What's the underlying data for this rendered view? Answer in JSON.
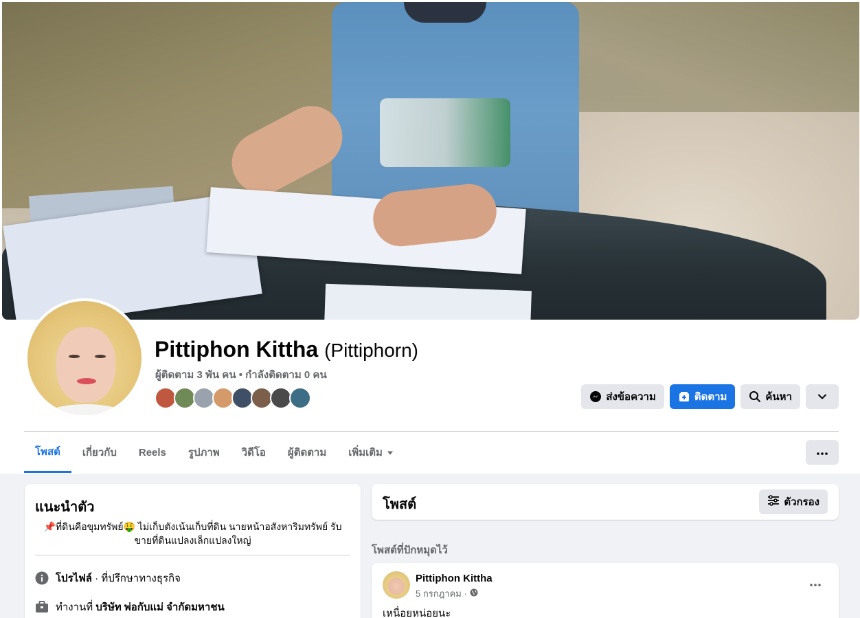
{
  "profile": {
    "name": "Pittiphon Kittha",
    "alt_name": "(Pittiphorn)",
    "follow_stats": "ผู้ติดตาม 3 พัน คน • กำลังติดตาม 0 คน",
    "follower_avatar_colors": [
      "#c0583f",
      "#6f8a56",
      "#9aa3ad",
      "#d59a6a",
      "#3f4f66",
      "#7b5f4a",
      "#4a4a4a",
      "#3d6e86"
    ]
  },
  "actions": {
    "message_label": "ส่งข้อความ",
    "follow_label": "ติดตาม",
    "search_label": "ค้นหา"
  },
  "tabs": [
    {
      "label": "โพสต์"
    },
    {
      "label": "เกี่ยวกับ"
    },
    {
      "label": "Reels"
    },
    {
      "label": "รูปภาพ"
    },
    {
      "label": "วิดีโอ"
    },
    {
      "label": "ผู้ติดตาม"
    },
    {
      "label": "เพิ่มเติม"
    }
  ],
  "intro": {
    "title": "แนะนำตัว",
    "bio": "📌ที่ดินคือขุมทรัพย์🤑 ไม่เก็บตังเน้นเก็บที่ดิน นายหน้าอสังหาริมทรัพย์ รับขายที่ดินแปลงเล็กแปลงใหญ่",
    "profile_label": "โปรไฟล์",
    "profile_category": " · ที่ปรึกษาทางธุรกิจ",
    "work_prefix": "ทำงานที่ ",
    "work_company": "บริษัท พ่อกับแม่ จำกัดมหาชน"
  },
  "posts": {
    "title": "โพสต์",
    "filter_label": "ตัวกรอง",
    "pinned_label": "โพสต์ที่ปักหมุดไว้",
    "pinned_post": {
      "author": "Pittiphon Kittha",
      "date": "5 กรกฎาคม ·",
      "text": "เหนื่อยหน่อยนะ"
    }
  },
  "colors": {
    "accent": "#1b74e4",
    "muted_text": "#65676b",
    "button_gray": "#e4e6eb",
    "background": "#f0f2f5"
  },
  "icons": {
    "message": "messenger-icon",
    "follow": "follow-icon",
    "search": "search-icon",
    "dropdown": "chevron-down-icon",
    "more": "more-dots-icon",
    "filter": "filter-icon",
    "info": "info-icon",
    "work": "briefcase-icon",
    "privacy": "globe-icon"
  }
}
